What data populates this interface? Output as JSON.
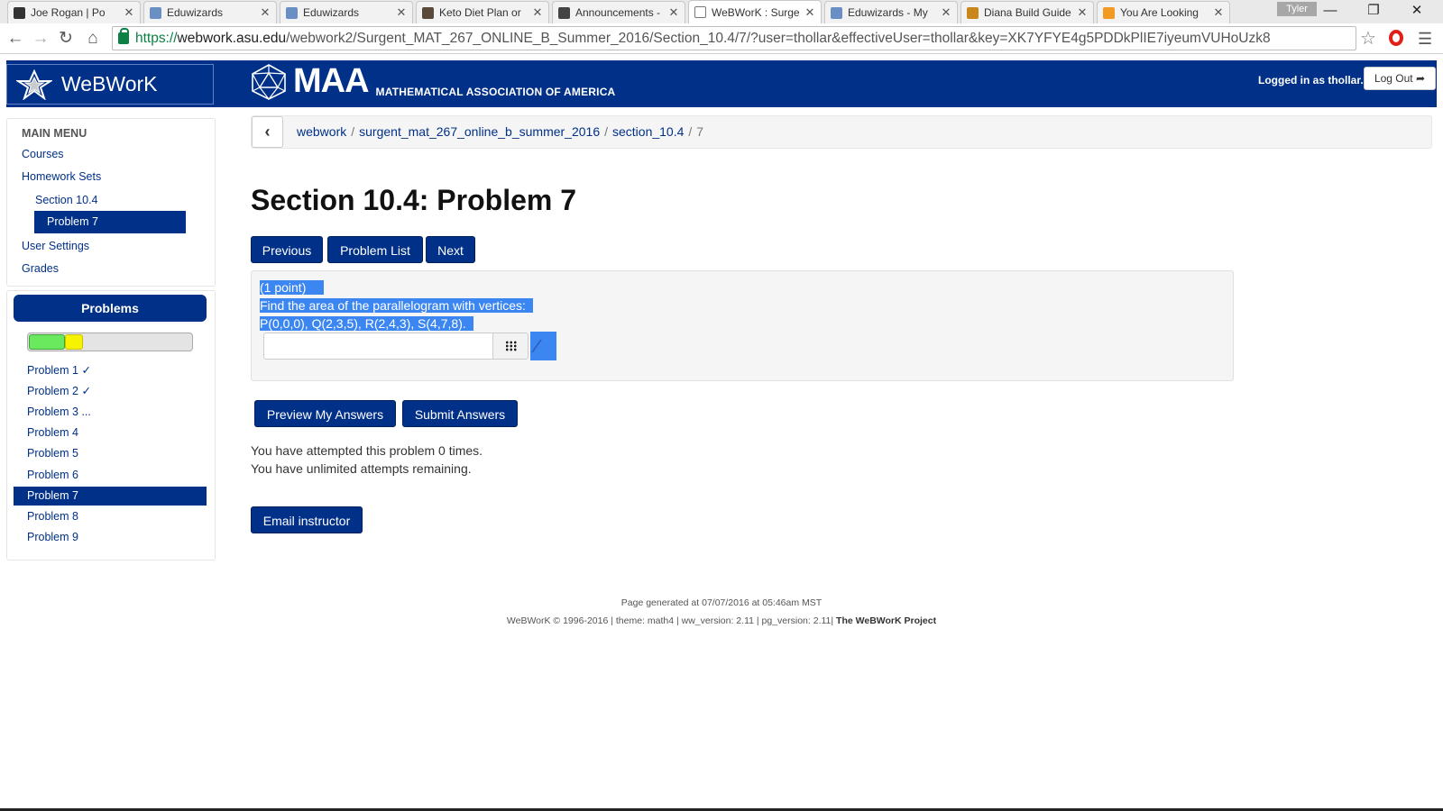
{
  "browser": {
    "tabs": [
      {
        "title": "Joe Rogan | Po",
        "favicon_color": "#333333",
        "favicon": "headphones-icon",
        "active": false
      },
      {
        "title": "Eduwizards",
        "favicon_color": "#6a8fc4",
        "favicon": "page-icon",
        "active": false
      },
      {
        "title": "Eduwizards",
        "favicon_color": "#6a8fc4",
        "favicon": "page-icon",
        "active": false
      },
      {
        "title": "Keto Diet Plan or",
        "favicon_color": "#5a4a3a",
        "favicon": "site-icon",
        "active": false
      },
      {
        "title": "Announcements -",
        "favicon_color": "#444444",
        "favicon": "bb-icon",
        "active": false
      },
      {
        "title": "WeBWorK : Surge",
        "favicon_color": "#ffffff",
        "favicon": "document-icon",
        "active": true
      },
      {
        "title": "Eduwizards - My",
        "favicon_color": "#6a8fc4",
        "favicon": "page-icon",
        "active": false
      },
      {
        "title": "Diana Build Guide",
        "favicon_color": "#c9861a",
        "favicon": "game-icon",
        "active": false
      },
      {
        "title": "You Are Looking",
        "favicon_color": "#f29a22",
        "favicon": "c-icon",
        "active": false
      }
    ],
    "profile_name": "Tyler",
    "url_scheme": "https://",
    "url_host": "webwork.asu.edu",
    "url_path": "/webwork2/Surgent_MAT_267_ONLINE_B_Summer_2016/Section_10.4/7/?user=thollar&effectiveUser=thollar&key=XK7YFYE4g5PDDkPlIE7iyeumVUHoUzk8"
  },
  "header": {
    "brand": "WeBWorK",
    "maa_title": "MAA",
    "maa_subtitle": "MATHEMATICAL ASSOCIATION OF AMERICA",
    "logged_in_text": "Logged in as thollar.",
    "logout_label": "Log Out"
  },
  "main_menu": {
    "title": "MAIN MENU",
    "items": [
      "Courses",
      "Homework Sets",
      "Section 10.4",
      "Problem 7",
      "User Settings",
      "Grades"
    ]
  },
  "problems_panel": {
    "title": "Problems",
    "progress_correct_fraction": 0.22,
    "progress_partial_fraction": 0.11,
    "items": [
      "Problem 1 ✓",
      "Problem 2 ✓",
      "Problem 3 ...",
      "Problem 4",
      "Problem 5",
      "Problem 6",
      "Problem 7",
      "Problem 8",
      "Problem 9"
    ],
    "active_index": 6
  },
  "breadcrumb": {
    "items": [
      "webwork",
      "surgent_mat_267_online_b_summer_2016",
      "section_10.4"
    ],
    "current": "7"
  },
  "page_title": "Section 10.4: Problem 7",
  "nav_buttons": {
    "previous": "Previous",
    "problem_list": "Problem List",
    "next": "Next"
  },
  "problem": {
    "points": "(1 point)",
    "line1": "Find the area of the parallelogram with vertices:",
    "line2": "P(0,0,0), Q(2,3,5), R(2,4,3), S(4,7,8).",
    "answer_value": ""
  },
  "actions": {
    "preview": "Preview My Answers",
    "submit": "Submit Answers",
    "email": "Email instructor"
  },
  "attempts": {
    "line1": "You have attempted this problem 0 times.",
    "line2": "You have unlimited attempts remaining."
  },
  "footer": {
    "generated": "Page generated at 07/07/2016 at 05:46am MST",
    "info": "WeBWorK © 1996-2016 | theme: math4 | ww_version: 2.11 | pg_version: 2.11|",
    "project": "The WeBWorK Project"
  },
  "colors": {
    "primary": "#003087",
    "selection": "#3b86f0",
    "progress_green": "#6ae95f",
    "progress_yellow": "#f7f200"
  }
}
